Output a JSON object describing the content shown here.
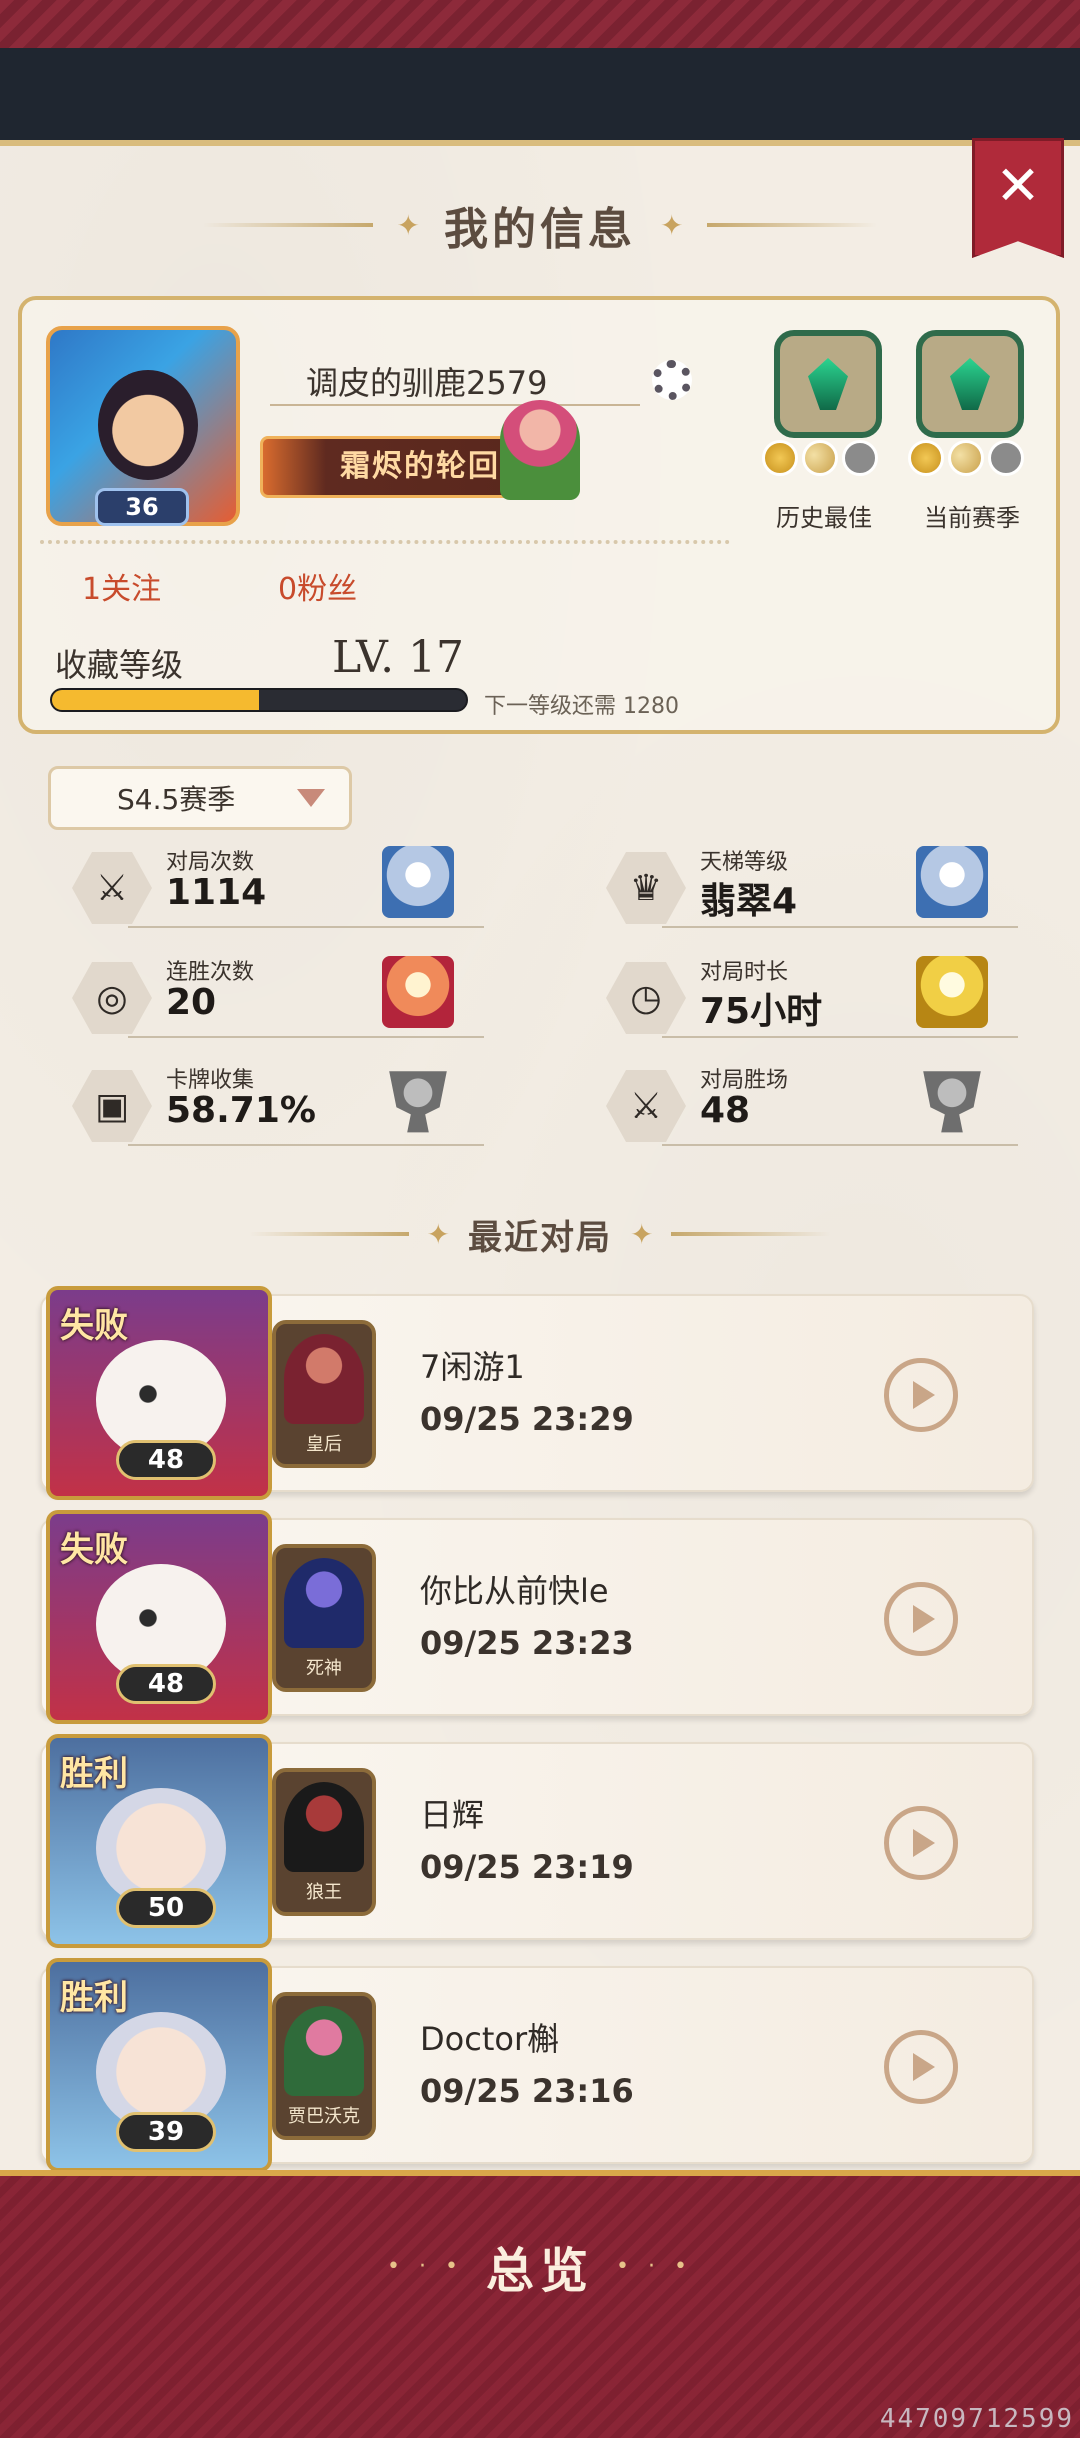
{
  "header": {
    "title": "我的信息",
    "close_icon": "close-icon"
  },
  "profile": {
    "avatar_level": "36",
    "username": "调皮的驯鹿2579",
    "title_banner": "霜烬的轮回",
    "following": "1关注",
    "followers": "0粉丝",
    "rank_history_label": "历史最佳",
    "rank_current_label": "当前赛季",
    "collection_label": "收藏等级",
    "collection_level": "LV. 17",
    "collection_progress": 0.5,
    "collection_next": "下一等级还需 1280"
  },
  "season": {
    "selected": "S4.5赛季"
  },
  "stats": [
    {
      "label": "对局次数",
      "value": "1114",
      "icon": "swords-icon",
      "trophy": "ice"
    },
    {
      "label": "天梯等级",
      "value": "翡翠4",
      "icon": "crown-icon",
      "trophy": "ice"
    },
    {
      "label": "连胜次数",
      "value": "20",
      "icon": "streak-icon",
      "trophy": "fire"
    },
    {
      "label": "对局时长",
      "value": "75小时",
      "icon": "clock-icon",
      "trophy": "gold"
    },
    {
      "label": "卡牌收集",
      "value": "58.71%",
      "icon": "card-icon",
      "trophy": "grey"
    },
    {
      "label": "对局胜场",
      "value": "48",
      "icon": "swords-icon",
      "trophy": "grey"
    }
  ],
  "recent": {
    "title": "最近对局",
    "matches": [
      {
        "result": "失败",
        "level": "48",
        "hero": "皇后",
        "opponent": "7闲游1",
        "time": "09/25 23:29"
      },
      {
        "result": "失败",
        "level": "48",
        "hero": "死神",
        "opponent": "你比从前快le",
        "time": "09/25 23:23"
      },
      {
        "result": "胜利",
        "level": "50",
        "hero": "狼王",
        "opponent": "日辉",
        "time": "09/25 23:19"
      },
      {
        "result": "胜利",
        "level": "39",
        "hero": "贾巴沃克",
        "opponent": "Doctor槲",
        "time": "09/25 23:16"
      }
    ]
  },
  "footer": {
    "overview_label": "总览",
    "id_text": "44709712599"
  },
  "colors": {
    "accent": "#7e2333",
    "gold": "#d4b36e",
    "progress": "#f5ba2f"
  }
}
